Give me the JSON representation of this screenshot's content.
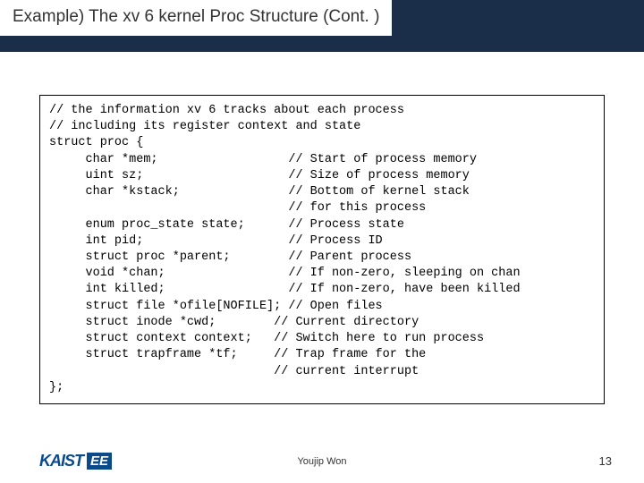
{
  "title": "Example) The xv 6 kernel Proc Structure (Cont. )",
  "code": "// the information xv 6 tracks about each process\n// including its register context and state\nstruct proc {\n     char *mem;                  // Start of process memory\n     uint sz;                    // Size of process memory\n     char *kstack;               // Bottom of kernel stack\n                                 // for this process\n     enum proc_state state;      // Process state\n     int pid;                    // Process ID\n     struct proc *parent;        // Parent process\n     void *chan;                 // If non-zero, sleeping on chan\n     int killed;                 // If non-zero, have been killed\n     struct file *ofile[NOFILE]; // Open files\n     struct inode *cwd;        // Current directory\n     struct context context;   // Switch here to run process\n     struct trapframe *tf;     // Trap frame for the\n                               // current interrupt\n};",
  "logo": {
    "part1": "KAIST",
    "part2": "EE"
  },
  "author": "Youjip Won",
  "page": "13"
}
